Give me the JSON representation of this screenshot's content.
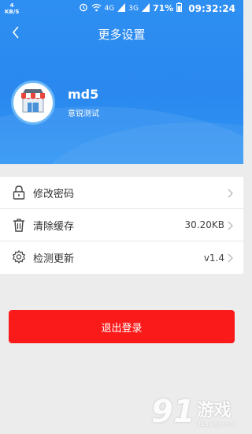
{
  "status_bar": {
    "net_speed_value": "4",
    "net_speed_unit": "KB/S",
    "signal_a": "4G",
    "signal_b": "3G",
    "battery_percent": "71%",
    "time": "09:32:24"
  },
  "header": {
    "title": "更多设置",
    "back_icon": "chevron-left-icon"
  },
  "profile": {
    "username": "md5",
    "store_name": "意锐测试",
    "avatar_icon": "storefront-icon"
  },
  "menu": [
    {
      "icon": "lock-icon",
      "label": "修改密码",
      "value": ""
    },
    {
      "icon": "trash-icon",
      "label": "清除缓存",
      "value": "30.20KB"
    },
    {
      "icon": "gear-icon",
      "label": "检测更新",
      "value": "v1.4"
    }
  ],
  "logout_label": "退出登录",
  "watermark": {
    "number": "91",
    "title": "游戏",
    "url": "91danji.com"
  },
  "colors": {
    "header_blue": "#2a88ee",
    "logout_red": "#fb1a1a",
    "background": "#ececec"
  }
}
